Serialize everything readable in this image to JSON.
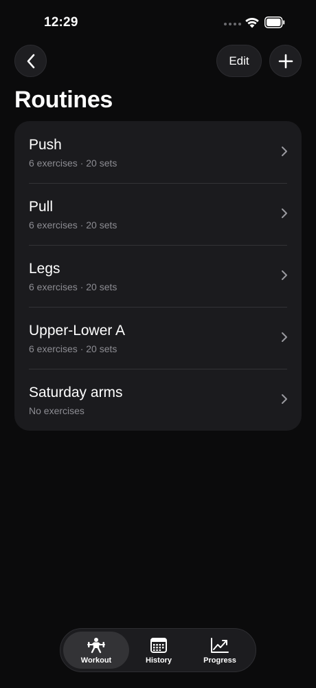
{
  "status_bar": {
    "time": "12:29"
  },
  "nav": {
    "back_icon": "chevron-left-icon",
    "edit_label": "Edit",
    "add_icon": "plus-icon"
  },
  "page": {
    "title": "Routines"
  },
  "routines": [
    {
      "name": "Push",
      "meta": "6 exercises · 20 sets"
    },
    {
      "name": "Pull",
      "meta": "6 exercises · 20 sets"
    },
    {
      "name": "Legs",
      "meta": "6 exercises · 20 sets"
    },
    {
      "name": "Upper-Lower A",
      "meta": "6 exercises · 20 sets"
    },
    {
      "name": "Saturday arms",
      "meta": "No exercises"
    }
  ],
  "tab_bar": {
    "tabs": [
      {
        "label": "Workout",
        "icon": "weightlifter-icon",
        "active": true
      },
      {
        "label": "History",
        "icon": "calendar-icon",
        "active": false
      },
      {
        "label": "Progress",
        "icon": "chart-trend-icon",
        "active": false
      }
    ]
  },
  "colors": {
    "background": "#0b0b0c",
    "card": "#1b1b1e",
    "secondary_text": "#8d8d93",
    "separator": "#333337"
  }
}
